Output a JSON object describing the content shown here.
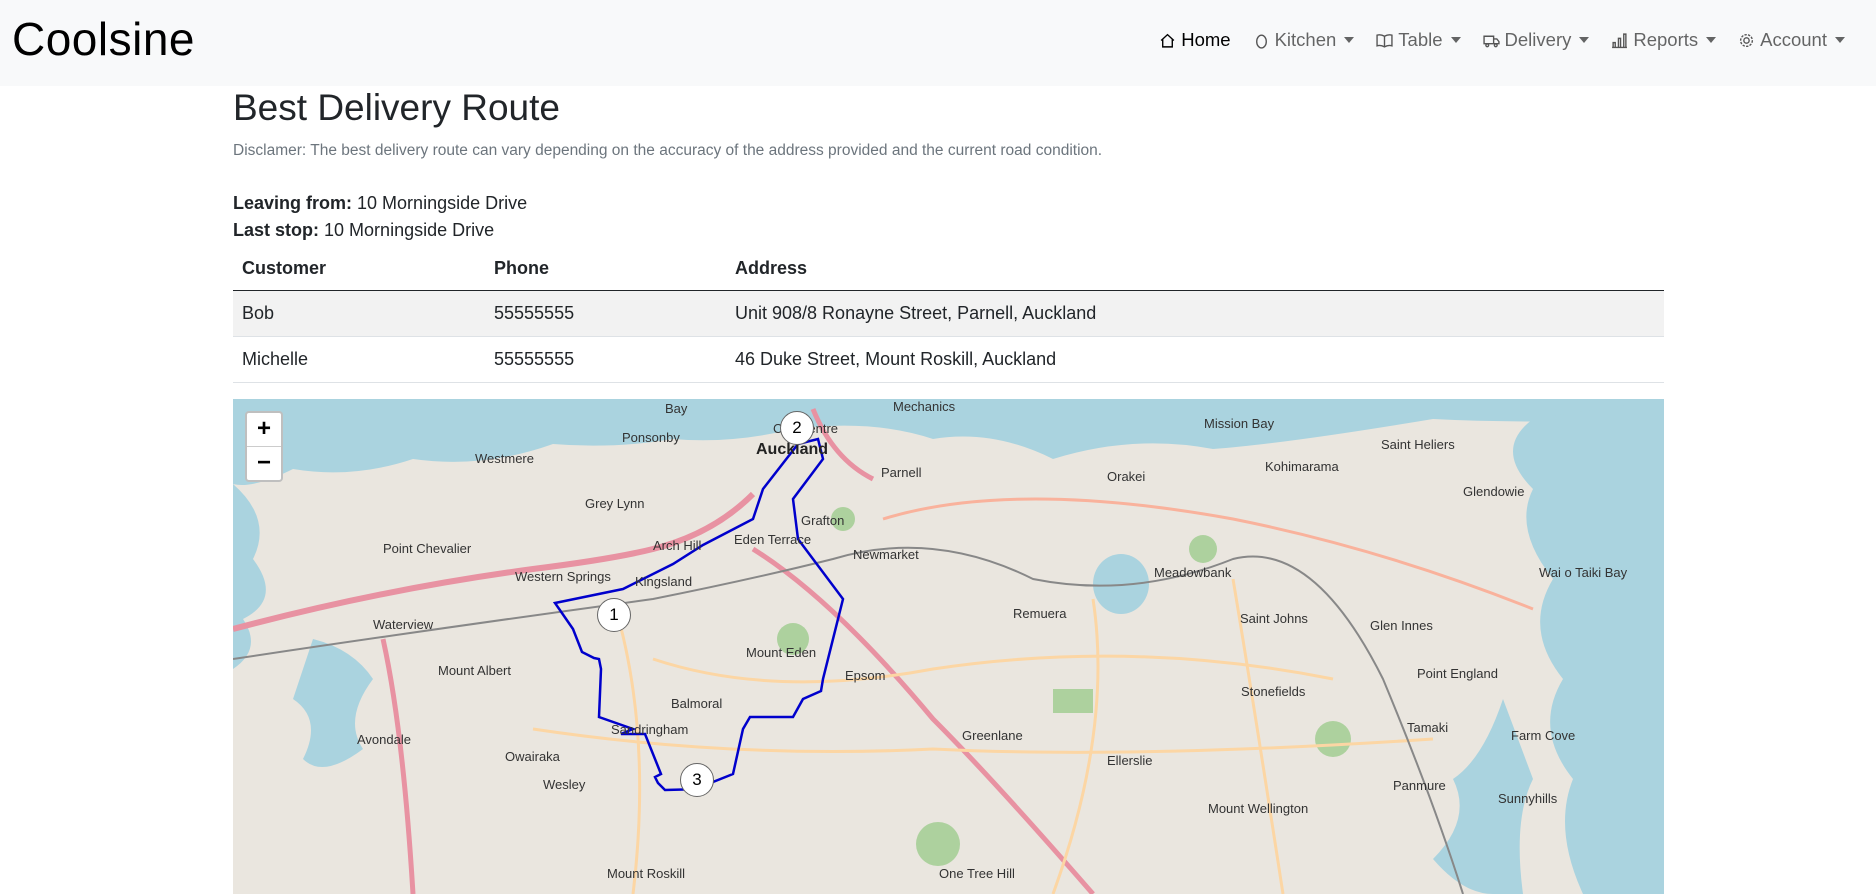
{
  "app": {
    "brand": "Coolsine"
  },
  "nav": {
    "items": [
      {
        "label": "Home",
        "icon": "home-icon"
      },
      {
        "label": "Kitchen",
        "icon": "egg-icon"
      },
      {
        "label": "Table",
        "icon": "book-icon"
      },
      {
        "label": "Delivery",
        "icon": "truck-icon"
      },
      {
        "label": "Reports",
        "icon": "bar-chart-icon"
      },
      {
        "label": "Account",
        "icon": "gear-icon"
      }
    ]
  },
  "page": {
    "title": "Best Delivery Route",
    "disclaimer": "Disclamer: The best delivery route can vary depending on the accuracy of the address provided and the current road condition.",
    "leaving_label": "Leaving from:",
    "leaving_value": "10 Morningside Drive",
    "last_label": "Last stop:",
    "last_value": "10 Morningside Drive"
  },
  "table": {
    "headers": [
      "Customer",
      "Phone",
      "Address"
    ],
    "rows": [
      [
        "Bob",
        "55555555",
        "Unit 908/8 Ronayne Street, Parnell, Auckland"
      ],
      [
        "Michelle",
        "55555555",
        "46 Duke Street, Mount Roskill, Auckland"
      ]
    ]
  },
  "map": {
    "zoom_in": "+",
    "zoom_out": "−",
    "markers": [
      "1",
      "2",
      "3"
    ],
    "route_color": "#0000cc",
    "labels": [
      "Bay",
      "Mechanics",
      "City Centre",
      "Auckland",
      "Ponsonby",
      "Westmere",
      "Grey Lynn",
      "Parnell",
      "Grafton",
      "Arch Hill",
      "Eden Terrace",
      "Point Chevalier",
      "Western Springs",
      "Kingsland",
      "Newmarket",
      "Waterview",
      "Mount Albert",
      "Mount Eden",
      "Balmoral",
      "Epsom",
      "Sandringham",
      "Owairaka",
      "Wesley",
      "Avondale",
      "Mount Roskill",
      "One Tree Hill",
      "Greenlane",
      "Remuera",
      "Meadowbank",
      "Orakei",
      "Mission Bay",
      "Kohimarama",
      "Saint Heliers",
      "Glendowie",
      "Saint Johns",
      "Glen Innes",
      "Stonefields",
      "Point England",
      "Tamaki",
      "Ellerslie",
      "Panmure",
      "Farm Cove",
      "Sunnyhills",
      "Mount Wellington",
      "Wai o Taiki Bay"
    ]
  }
}
